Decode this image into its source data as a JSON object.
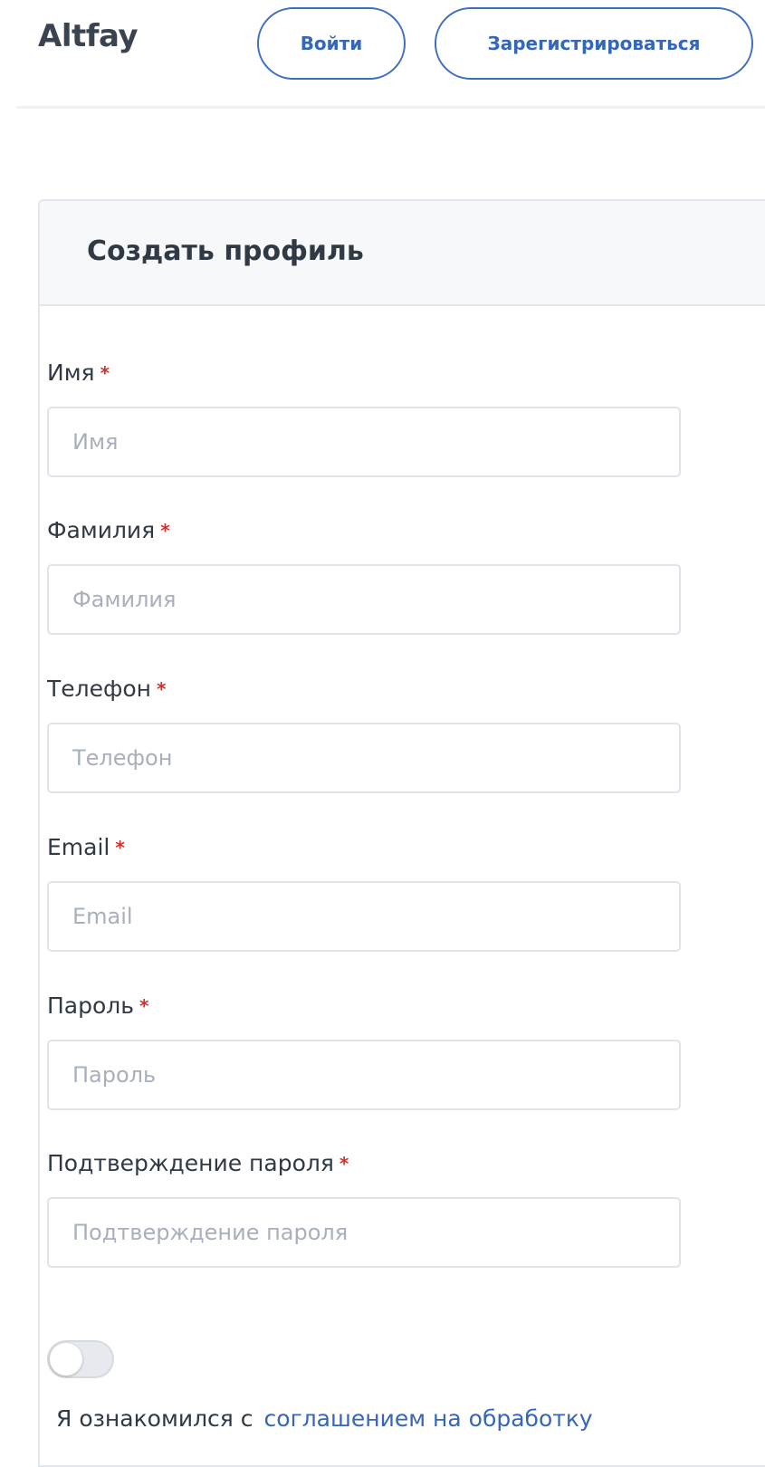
{
  "header": {
    "brand": "Altfay",
    "login_label": "Войти",
    "register_label": "Зарегистрироваться"
  },
  "card": {
    "title": "Создать профиль",
    "required_mark": "*",
    "fields": [
      {
        "label": "Имя",
        "placeholder": "Имя",
        "value": ""
      },
      {
        "label": "Фамилия",
        "placeholder": "Фамилия",
        "value": ""
      },
      {
        "label": "Телефон",
        "placeholder": "Телефон",
        "value": ""
      },
      {
        "label": "Email",
        "placeholder": "Email",
        "value": ""
      },
      {
        "label": "Пароль",
        "placeholder": "Пароль",
        "value": ""
      },
      {
        "label": "Подтверждение пароля",
        "placeholder": "Подтверждение пароля",
        "value": ""
      }
    ],
    "consent": {
      "toggle_on": false,
      "text": "Я ознакомился с",
      "link_text": "соглашением на обработку"
    }
  },
  "colors": {
    "accent": "#3566b8",
    "required": "#d0312d",
    "text": "#2f3a45",
    "placeholder": "#a7b0bc"
  }
}
